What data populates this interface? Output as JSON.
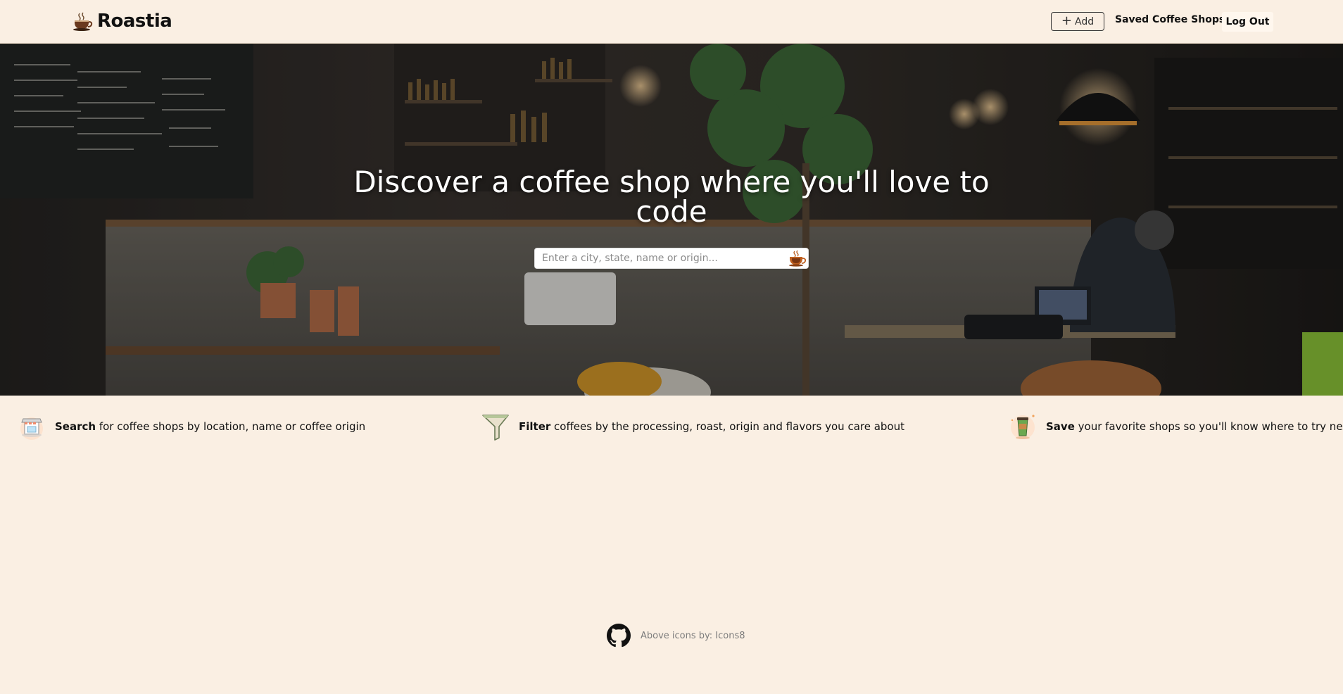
{
  "header": {
    "brand": "Roastia",
    "add_label": "Add",
    "saved_label": "Saved Coffee Shops",
    "logout_label": "Log Out"
  },
  "hero": {
    "title": "Discover a coffee shop where you'll love to code",
    "search_placeholder": "Enter a city, state, name or origin..."
  },
  "features": [
    {
      "keyword": "Search",
      "text": " for coffee shops by location, name or coffee origin",
      "icon": "store-icon"
    },
    {
      "keyword": "Filter",
      "text": " coffees by the processing, roast, origin and flavors you care about",
      "icon": "funnel-icon"
    },
    {
      "keyword": "Save",
      "text": " your favorite shops so you'll know where to try next",
      "icon": "coffee-cup-icon"
    }
  ],
  "footer": {
    "credit": "Above icons by: Icons8",
    "github_icon": "github-icon"
  },
  "colors": {
    "background": "#faefe3",
    "text": "#111111",
    "muted": "#7c7c7c",
    "accent": "#b85c1e"
  }
}
